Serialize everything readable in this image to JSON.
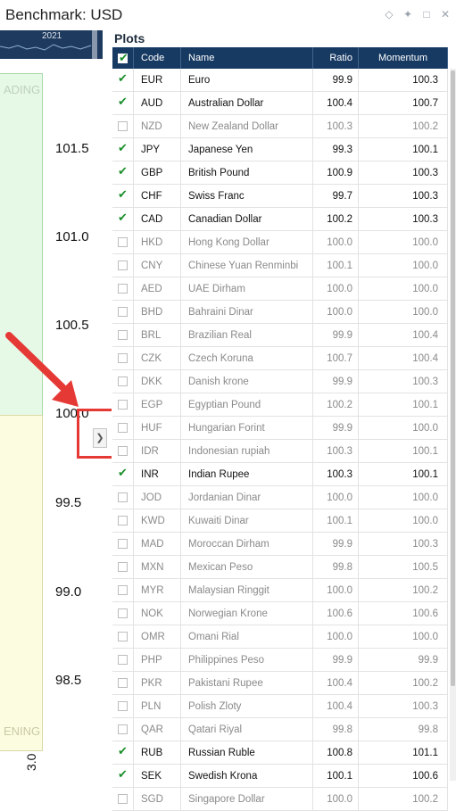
{
  "header": {
    "title": "Benchmark:  USD"
  },
  "left_panel": {
    "timeline_year": "2021",
    "zone_top_label": "ADING",
    "zone_bottom_label": "ENING",
    "y_ticks": [
      "101.5",
      "101.0",
      "100.5",
      "100.0",
      "99.5",
      "99.0",
      "98.5"
    ],
    "x_partial": "3.0"
  },
  "plots": {
    "title": "Plots",
    "columns": {
      "code": "Code",
      "name": "Name",
      "ratio": "Ratio",
      "momentum": "Momentum"
    },
    "rows": [
      {
        "checked": true,
        "code": "EUR",
        "name": "Euro",
        "ratio": "99.9",
        "momentum": "100.3"
      },
      {
        "checked": true,
        "code": "AUD",
        "name": "Australian Dollar",
        "ratio": "100.4",
        "momentum": "100.7"
      },
      {
        "checked": false,
        "code": "NZD",
        "name": "New Zealand Dollar",
        "ratio": "100.3",
        "momentum": "100.2"
      },
      {
        "checked": true,
        "code": "JPY",
        "name": "Japanese Yen",
        "ratio": "99.3",
        "momentum": "100.1"
      },
      {
        "checked": true,
        "code": "GBP",
        "name": "British Pound",
        "ratio": "100.9",
        "momentum": "100.3"
      },
      {
        "checked": true,
        "code": "CHF",
        "name": "Swiss Franc",
        "ratio": "99.7",
        "momentum": "100.3"
      },
      {
        "checked": true,
        "code": "CAD",
        "name": "Canadian Dollar",
        "ratio": "100.2",
        "momentum": "100.3"
      },
      {
        "checked": false,
        "code": "HKD",
        "name": "Hong Kong Dollar",
        "ratio": "100.0",
        "momentum": "100.0"
      },
      {
        "checked": false,
        "code": "CNY",
        "name": "Chinese Yuan Renminbi",
        "ratio": "100.1",
        "momentum": "100.0"
      },
      {
        "checked": false,
        "code": "AED",
        "name": "UAE Dirham",
        "ratio": "100.0",
        "momentum": "100.0"
      },
      {
        "checked": false,
        "code": "BHD",
        "name": "Bahraini Dinar",
        "ratio": "100.0",
        "momentum": "100.0"
      },
      {
        "checked": false,
        "code": "BRL",
        "name": "Brazilian Real",
        "ratio": "99.9",
        "momentum": "100.4"
      },
      {
        "checked": false,
        "code": "CZK",
        "name": "Czech Koruna",
        "ratio": "100.7",
        "momentum": "100.4"
      },
      {
        "checked": false,
        "code": "DKK",
        "name": "Danish krone",
        "ratio": "99.9",
        "momentum": "100.3"
      },
      {
        "checked": false,
        "code": "EGP",
        "name": "Egyptian Pound",
        "ratio": "100.2",
        "momentum": "100.1"
      },
      {
        "checked": false,
        "code": "HUF",
        "name": "Hungarian Forint",
        "ratio": "99.9",
        "momentum": "100.0"
      },
      {
        "checked": false,
        "code": "IDR",
        "name": "Indonesian rupiah",
        "ratio": "100.3",
        "momentum": "100.1"
      },
      {
        "checked": true,
        "code": "INR",
        "name": "Indian Rupee",
        "ratio": "100.3",
        "momentum": "100.1"
      },
      {
        "checked": false,
        "code": "JOD",
        "name": "Jordanian Dinar",
        "ratio": "100.0",
        "momentum": "100.0"
      },
      {
        "checked": false,
        "code": "KWD",
        "name": "Kuwaiti Dinar",
        "ratio": "100.1",
        "momentum": "100.0"
      },
      {
        "checked": false,
        "code": "MAD",
        "name": "Moroccan Dirham",
        "ratio": "99.9",
        "momentum": "100.3"
      },
      {
        "checked": false,
        "code": "MXN",
        "name": "Mexican Peso",
        "ratio": "99.8",
        "momentum": "100.5"
      },
      {
        "checked": false,
        "code": "MYR",
        "name": "Malaysian Ringgit",
        "ratio": "100.0",
        "momentum": "100.2"
      },
      {
        "checked": false,
        "code": "NOK",
        "name": "Norwegian Krone",
        "ratio": "100.6",
        "momentum": "100.6"
      },
      {
        "checked": false,
        "code": "OMR",
        "name": "Omani Rial",
        "ratio": "100.0",
        "momentum": "100.0"
      },
      {
        "checked": false,
        "code": "PHP",
        "name": "Philippines Peso",
        "ratio": "99.9",
        "momentum": "99.9"
      },
      {
        "checked": false,
        "code": "PKR",
        "name": "Pakistani Rupee",
        "ratio": "100.4",
        "momentum": "100.2"
      },
      {
        "checked": false,
        "code": "PLN",
        "name": "Polish Zloty",
        "ratio": "100.4",
        "momentum": "100.3"
      },
      {
        "checked": false,
        "code": "QAR",
        "name": "Qatari Riyal",
        "ratio": "99.8",
        "momentum": "99.8"
      },
      {
        "checked": true,
        "code": "RUB",
        "name": "Russian Ruble",
        "ratio": "100.8",
        "momentum": "101.1"
      },
      {
        "checked": true,
        "code": "SEK",
        "name": "Swedish Krona",
        "ratio": "100.1",
        "momentum": "100.6"
      },
      {
        "checked": false,
        "code": "SGD",
        "name": "Singapore Dollar",
        "ratio": "100.0",
        "momentum": "100.2"
      }
    ]
  }
}
